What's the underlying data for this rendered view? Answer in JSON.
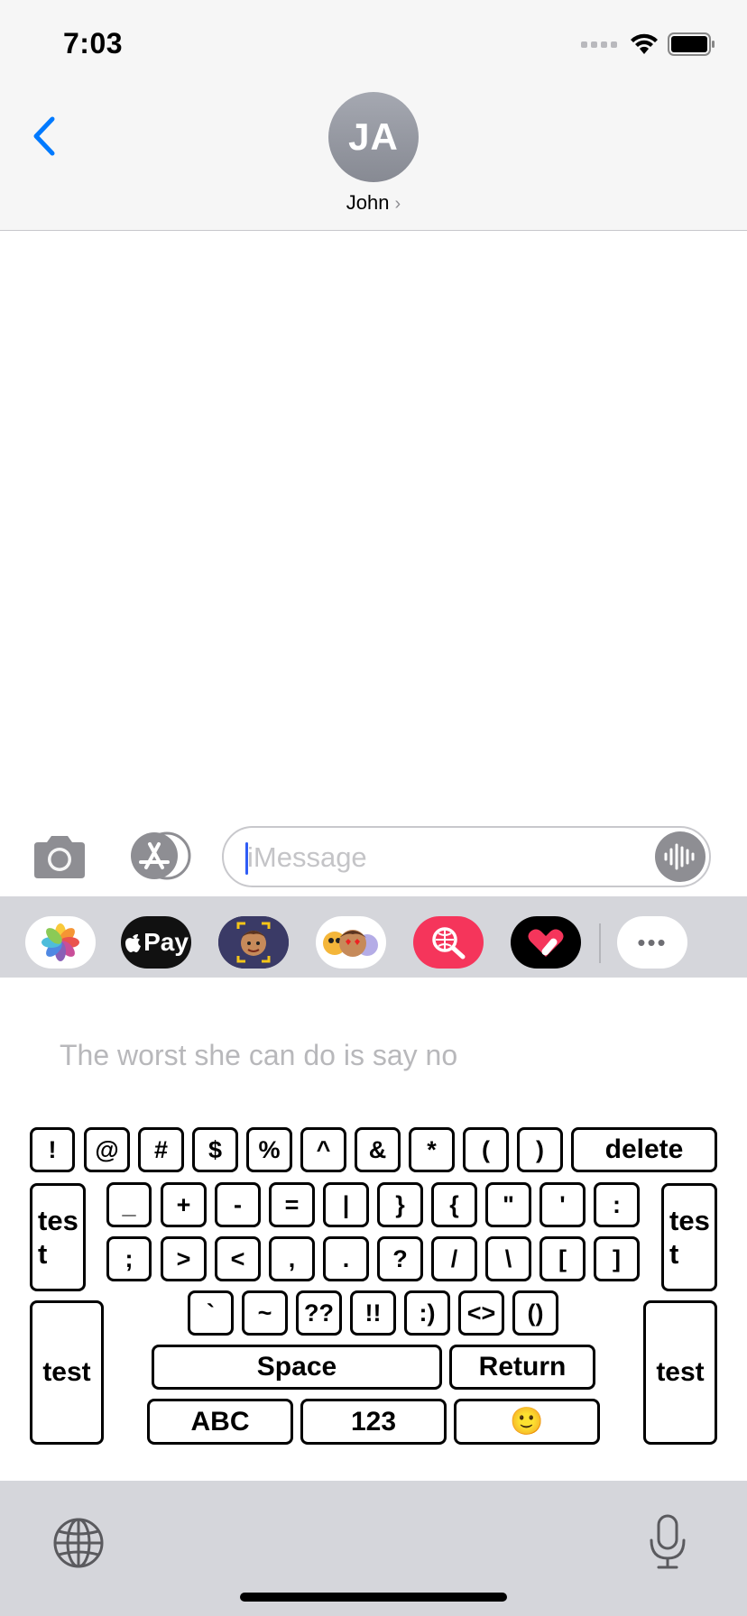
{
  "status_bar": {
    "time": "7:03"
  },
  "header": {
    "avatar_initials": "JA",
    "contact_name": "John",
    "chevron": "›"
  },
  "composer": {
    "placeholder": "iMessage",
    "value": ""
  },
  "apps": [
    {
      "name": "photos-icon"
    },
    {
      "name": "apple-pay-icon",
      "label": "Pay",
      "apple_glyph": ""
    },
    {
      "name": "memoji-icon"
    },
    {
      "name": "memoji-stickers-icon"
    },
    {
      "name": "image-search-icon"
    },
    {
      "name": "digital-touch-icon"
    },
    {
      "name": "more-apps-icon",
      "label": "•••"
    }
  ],
  "keyboard": {
    "suggestion": "The worst she can do is say no",
    "row1": [
      "!",
      "@",
      "#",
      "$",
      "%",
      "^",
      "&",
      "*",
      "(",
      ")"
    ],
    "delete_label": "delete",
    "row2": [
      "_",
      "+",
      "-",
      "=",
      "|",
      "}",
      "{",
      "\"",
      "'",
      ":"
    ],
    "row3": [
      ";",
      ">",
      "<",
      ",",
      ".",
      "?",
      "/",
      "\\",
      "[",
      "]"
    ],
    "row4": [
      "`",
      "~",
      "??",
      "!!",
      ":)",
      "<>",
      "()"
    ],
    "test_label": "test",
    "space_label": "Space",
    "return_label": "Return",
    "abc_label": "ABC",
    "num_label": "123",
    "emoji_label": "🙂"
  },
  "colors": {
    "accent": "#007aff",
    "key_border": "#000000",
    "strip_bg": "#d5d6db",
    "pink": "#f5355b"
  }
}
